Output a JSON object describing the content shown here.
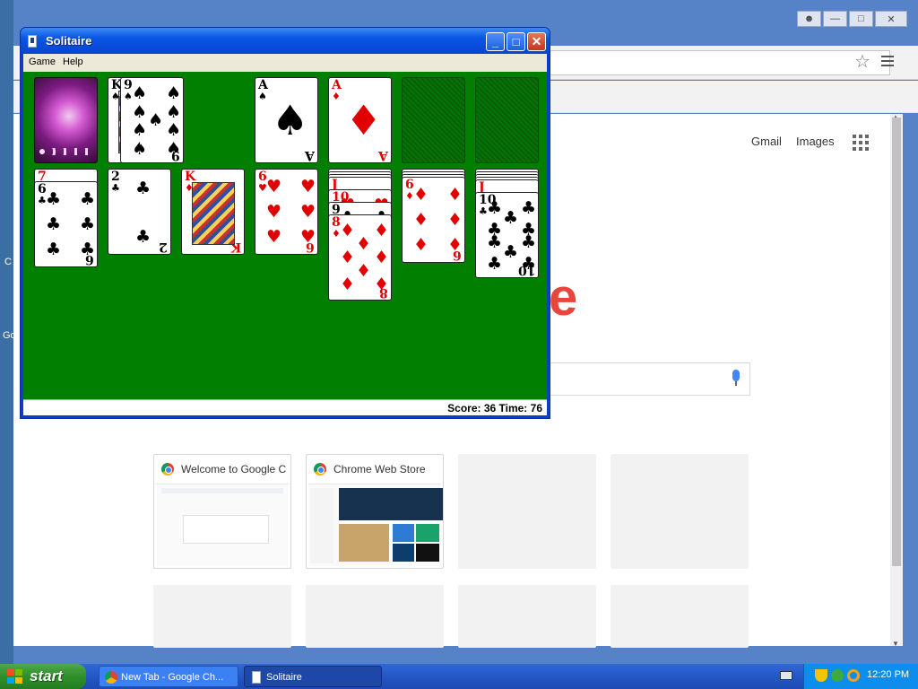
{
  "desktop": {
    "fragments": [
      "C",
      "Go"
    ]
  },
  "chrome": {
    "titlebar_buttons": [
      "user-icon",
      "minimize-icon",
      "maximize-icon",
      "close-icon"
    ],
    "links": {
      "gmail": "Gmail",
      "images": "Images"
    },
    "logo_fragment": "e",
    "tiles": [
      {
        "title": "Welcome to Google Chrome",
        "icon": "chrome-icon"
      },
      {
        "title": "Chrome Web Store",
        "icon": "webstore-icon"
      },
      {
        "title": ""
      },
      {
        "title": ""
      },
      {
        "title": ""
      },
      {
        "title": ""
      },
      {
        "title": ""
      },
      {
        "title": ""
      }
    ]
  },
  "solitaire": {
    "title": "Solitaire",
    "menu": {
      "game": "Game",
      "help": "Help"
    },
    "status": "Score: 36 Time: 76",
    "stock": {
      "type": "card-back"
    },
    "waste": [
      {
        "rank": "K",
        "suit": "♠"
      },
      {
        "rank": "9",
        "suit": "♠"
      }
    ],
    "foundations": [
      {
        "rank": "A",
        "suit": "♠"
      },
      {
        "rank": "A",
        "suit": "♦"
      },
      null,
      null
    ],
    "tableau": [
      {
        "hidden": 0,
        "cards": [
          {
            "rank": "7",
            "suit": "♥"
          },
          {
            "rank": "6",
            "suit": "♣"
          }
        ]
      },
      {
        "hidden": 0,
        "cards": [
          {
            "rank": "2",
            "suit": "♣"
          }
        ]
      },
      {
        "hidden": 0,
        "cards": [
          {
            "rank": "K",
            "suit": "♦"
          }
        ]
      },
      {
        "hidden": 0,
        "cards": [
          {
            "rank": "6",
            "suit": "♥"
          }
        ]
      },
      {
        "hidden": 3,
        "cards": [
          {
            "rank": "J",
            "suit": "♥"
          },
          {
            "rank": "10",
            "suit": "♥"
          },
          {
            "rank": "9",
            "suit": "♣"
          },
          {
            "rank": "8",
            "suit": "♦"
          }
        ]
      },
      {
        "hidden": 3,
        "cards": [
          {
            "rank": "6",
            "suit": "♦"
          }
        ]
      },
      {
        "hidden": 4,
        "cards": [
          {
            "rank": "J",
            "suit": "♦"
          },
          {
            "rank": "10",
            "suit": "♣"
          }
        ]
      }
    ]
  },
  "taskbar": {
    "start": "start",
    "tasks": [
      {
        "label": "New Tab - Google Ch...",
        "icon": "chrome-icon",
        "active": false
      },
      {
        "label": "Solitaire",
        "icon": "solitaire-icon",
        "active": true
      }
    ],
    "clock": "12:20 PM",
    "tray_icons": [
      "keyboard-icon",
      "security-shield-icon",
      "network-icon",
      "search-icon"
    ]
  }
}
